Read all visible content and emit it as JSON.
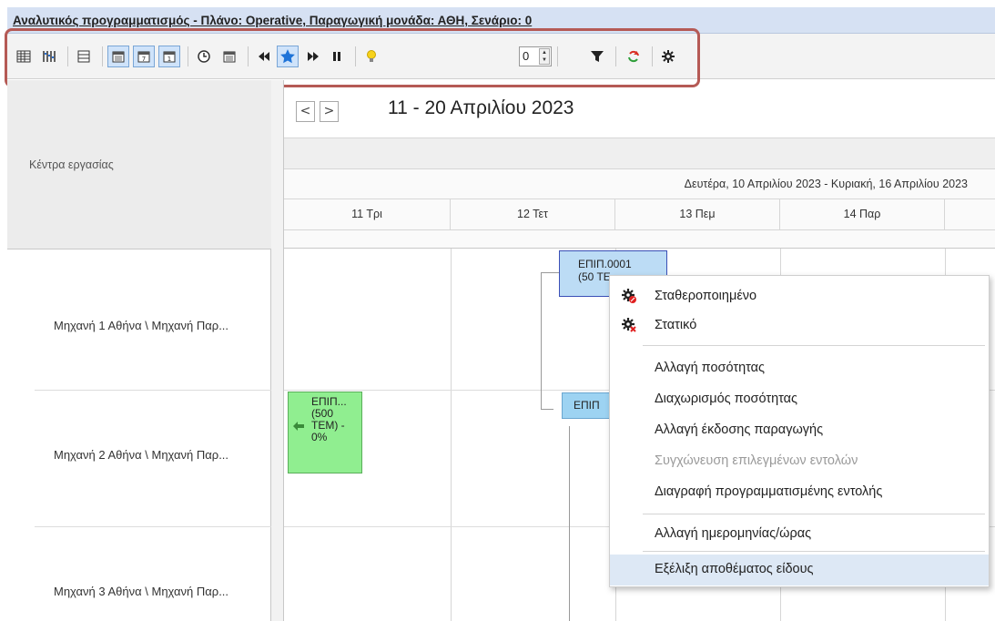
{
  "window": {
    "title": "Αναλυτικός προγραμματισμός - Πλάνο: Operative, Παραγωγική μονάδα: ΑΘΗ, Σενάριο: 0"
  },
  "toolbar": {
    "buttons": [
      {
        "icon": "grid-view-icon",
        "pressed": false
      },
      {
        "icon": "column-view-icon",
        "pressed": false
      },
      {
        "icon": "list-view-icon",
        "pressed": false
      },
      {
        "icon": "calendar-month-icon",
        "pressed": true
      },
      {
        "icon": "calendar-week-icon",
        "pressed": true
      },
      {
        "icon": "calendar-day-icon",
        "pressed": true
      },
      {
        "icon": "clock-icon",
        "pressed": false
      },
      {
        "icon": "calendar-icon",
        "pressed": false
      },
      {
        "icon": "rewind-icon",
        "pressed": false
      },
      {
        "icon": "star-icon",
        "pressed": true
      },
      {
        "icon": "fast-forward-icon",
        "pressed": false
      },
      {
        "icon": "pause-icon",
        "pressed": false
      },
      {
        "icon": "lightbulb-icon",
        "pressed": false
      },
      {
        "icon": "filter-icon",
        "pressed": false
      },
      {
        "icon": "refresh-icon",
        "pressed": false
      },
      {
        "icon": "gear-icon",
        "pressed": false
      }
    ],
    "spinner_value": "0"
  },
  "left_panel": {
    "header": "Κέντρα εργασίας",
    "machines": [
      "Μηχανή 1 Αθήνα \\ Μηχανή Παρ...",
      "Μηχανή 2 Αθήνα \\ Μηχανή Παρ...",
      "Μηχανή 3 Αθήνα \\ Μηχανή Παρ..."
    ]
  },
  "calendar": {
    "date_range": "11 - 20 Απριλίου 2023",
    "prev_label": "<",
    "next_label": ">",
    "week_label": "Δευτέρα, 10 Απριλίου 2023 - Κυριακή, 16 Απριλίου 2023",
    "days": [
      "11 Τρι",
      "12 Τετ",
      "13 Πεμ",
      "14 Παρ"
    ]
  },
  "tasks": {
    "task1_line1": "ΕΠΙΠ.0001",
    "task1_line2": "(50 ΤΕ",
    "task2_label": "ΕΠΙΠ",
    "task3_line1": "ΕΠΙΠ...",
    "task3_line2": "(500",
    "task3_line3": "ΤΕΜ) -",
    "task3_line4": "0%"
  },
  "context_menu": {
    "items": [
      {
        "label": "Σταθεροποιημένο",
        "icon": "gear-stop-icon",
        "disabled": false
      },
      {
        "label": "Στατικό",
        "icon": "gear-x-icon",
        "disabled": false
      },
      {
        "label": "Αλλαγή ποσότητας",
        "disabled": false
      },
      {
        "label": "Διαχωρισμός ποσότητας",
        "disabled": false
      },
      {
        "label": "Αλλαγή έκδοσης παραγωγής",
        "disabled": false
      },
      {
        "label": "Συγχώνευση επιλεγμένων εντολών",
        "disabled": true
      },
      {
        "label": "Διαγραφή προγραμματισμένης εντολής",
        "disabled": false
      },
      {
        "label": "Αλλαγή ημερομηνίας/ώρας",
        "disabled": false
      },
      {
        "label": "Εξέλιξη αποθέματος είδους",
        "disabled": false,
        "hovered": true
      }
    ]
  },
  "colors": {
    "title_bg": "#d6e1f3",
    "highlight_border": "#b55a55",
    "task_blue": "#bcdcf5",
    "task_green": "#90ee90",
    "menu_hover": "#dde8f5"
  }
}
